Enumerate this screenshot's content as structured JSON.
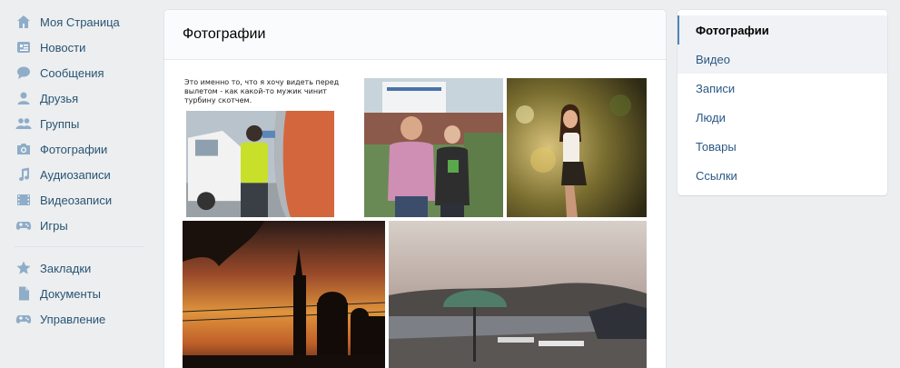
{
  "left_nav": {
    "items": [
      {
        "label": "Моя Страница",
        "icon": "home-icon"
      },
      {
        "label": "Новости",
        "icon": "news-icon"
      },
      {
        "label": "Сообщения",
        "icon": "messages-icon"
      },
      {
        "label": "Друзья",
        "icon": "friends-icon"
      },
      {
        "label": "Группы",
        "icon": "groups-icon"
      },
      {
        "label": "Фотографии",
        "icon": "camera-icon"
      },
      {
        "label": "Аудиозаписи",
        "icon": "music-icon"
      },
      {
        "label": "Видеозаписи",
        "icon": "video-icon"
      },
      {
        "label": "Игры",
        "icon": "gamepad-icon"
      }
    ],
    "extra_items": [
      {
        "label": "Закладки",
        "icon": "star-icon"
      },
      {
        "label": "Документы",
        "icon": "document-icon"
      },
      {
        "label": "Управление",
        "icon": "gamepad-icon"
      }
    ]
  },
  "main": {
    "title": "Фотографии",
    "meme_caption": "Это именно то, что я хочу видеть перед вылетом - как какой-то мужик чинит турбину скотчем."
  },
  "right_menu": {
    "items": [
      {
        "label": "Фотографии",
        "active": true
      },
      {
        "label": "Видео"
      },
      {
        "label": "Записи"
      },
      {
        "label": "Люди"
      },
      {
        "label": "Товары"
      },
      {
        "label": "Ссылки"
      }
    ]
  },
  "colors": {
    "background": "#edeef0",
    "link": "#285473",
    "accent": "#5181b8",
    "icon": "#8fadc8"
  }
}
